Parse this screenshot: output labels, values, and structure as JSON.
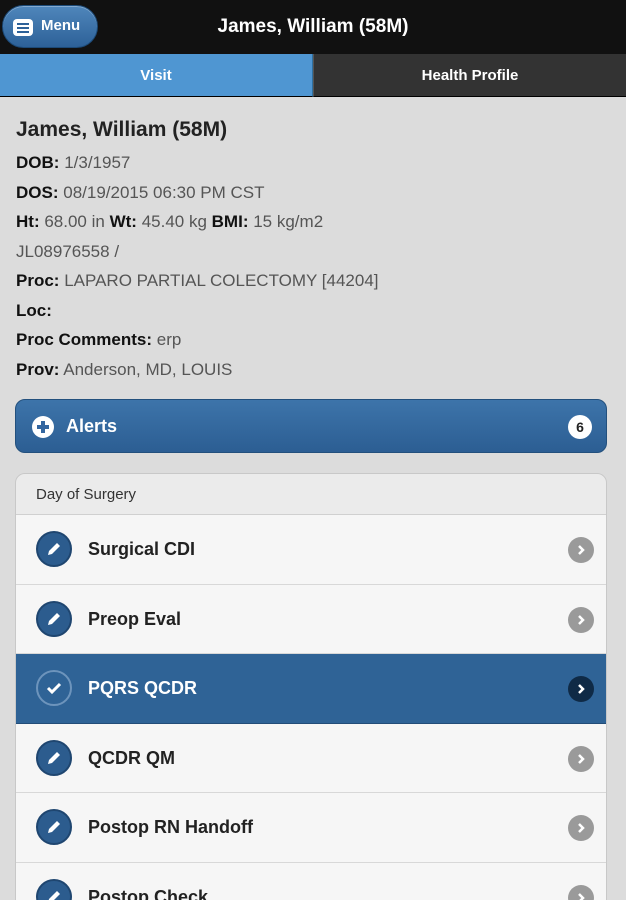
{
  "header": {
    "menu_label": "Menu",
    "title": "James, William (58M)"
  },
  "tabs": [
    {
      "label": "Visit",
      "active": true
    },
    {
      "label": "Health Profile",
      "active": false
    }
  ],
  "patient": {
    "name": "James, William (58M)",
    "dob_label": "DOB:",
    "dob": "1/3/1957",
    "dos_label": "DOS:",
    "dos": "08/19/2015 06:30 PM CST",
    "ht_label": "Ht:",
    "ht": "68.00 in",
    "wt_label": "Wt:",
    "wt": "45.40 kg",
    "bmi_label": "BMI:",
    "bmi": "15 kg/m2",
    "id_line": "JL08976558 /",
    "proc_label": "Proc:",
    "proc": "LAPARO PARTIAL COLECTOMY [44204]",
    "loc_label": "Loc:",
    "loc": "",
    "proc_comments_label": "Proc Comments:",
    "proc_comments": "erp",
    "prov_label": "Prov:",
    "prov": "Anderson, MD, LOUIS"
  },
  "alerts": {
    "label": "Alerts",
    "count": "6"
  },
  "day_of_surgery": {
    "header": "Day of Surgery",
    "items": [
      {
        "label": "Surgical CDI",
        "icon": "pencil-icon",
        "active": false
      },
      {
        "label": "Preop Eval",
        "icon": "pencil-icon",
        "active": false
      },
      {
        "label": "PQRS QCDR",
        "icon": "check-icon",
        "active": true
      },
      {
        "label": "QCDR QM",
        "icon": "pencil-icon",
        "active": false
      },
      {
        "label": "Postop RN Handoff",
        "icon": "pencil-icon",
        "active": false
      },
      {
        "label": "Postop Check",
        "icon": "pencil-icon",
        "active": false
      }
    ]
  },
  "colors": {
    "header_bg": "#111111",
    "menu_button": "#3a70a8",
    "tab_active": "#4f96d2",
    "tab_inactive": "#333333",
    "alerts_bar": "#3366a0",
    "row_active": "#2f6396"
  }
}
